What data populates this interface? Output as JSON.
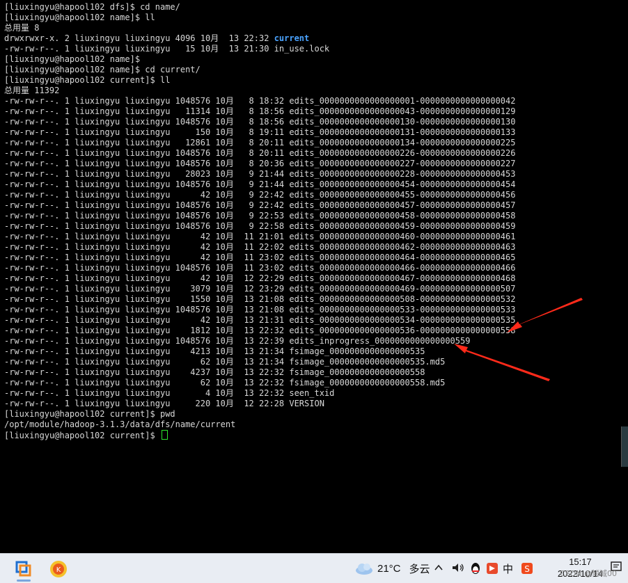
{
  "terminal": {
    "lines": [
      "[liuxingyu@hapool102 dfs]$ cd name/",
      "[liuxingyu@hapool102 name]$ ll",
      "总用量 8"
    ],
    "dir_line_prefix": "drwxrwxr-x. 2 liuxingyu liuxingyu 4096 10月  13 22:32 ",
    "dir_name": "current",
    "lines2": [
      "-rw-rw-r--. 1 liuxingyu liuxingyu   15 10月  13 21:30 in_use.lock",
      "[liuxingyu@hapool102 name]$",
      "[liuxingyu@hapool102 name]$ cd current/",
      "[liuxingyu@hapool102 current]$ ll",
      "总用量 11392",
      "-rw-rw-r--. 1 liuxingyu liuxingyu 1048576 10月   8 18:32 edits_0000000000000000001-0000000000000000042",
      "-rw-rw-r--. 1 liuxingyu liuxingyu   11314 10月   8 18:56 edits_0000000000000000043-0000000000000000129",
      "-rw-rw-r--. 1 liuxingyu liuxingyu 1048576 10月   8 18:56 edits_0000000000000000130-0000000000000000130",
      "-rw-rw-r--. 1 liuxingyu liuxingyu     150 10月   8 19:11 edits_0000000000000000131-0000000000000000133",
      "-rw-rw-r--. 1 liuxingyu liuxingyu   12861 10月   8 20:11 edits_0000000000000000134-0000000000000000225",
      "-rw-rw-r--. 1 liuxingyu liuxingyu 1048576 10月   8 20:11 edits_0000000000000000226-0000000000000000226",
      "-rw-rw-r--. 1 liuxingyu liuxingyu 1048576 10月   8 20:36 edits_0000000000000000227-0000000000000000227",
      "-rw-rw-r--. 1 liuxingyu liuxingyu   28023 10月   9 21:44 edits_0000000000000000228-0000000000000000453",
      "-rw-rw-r--. 1 liuxingyu liuxingyu 1048576 10月   9 21:44 edits_0000000000000000454-0000000000000000454",
      "-rw-rw-r--. 1 liuxingyu liuxingyu      42 10月   9 22:42 edits_0000000000000000455-0000000000000000456",
      "-rw-rw-r--. 1 liuxingyu liuxingyu 1048576 10月   9 22:42 edits_0000000000000000457-0000000000000000457",
      "-rw-rw-r--. 1 liuxingyu liuxingyu 1048576 10月   9 22:53 edits_0000000000000000458-0000000000000000458",
      "-rw-rw-r--. 1 liuxingyu liuxingyu 1048576 10月   9 22:58 edits_0000000000000000459-0000000000000000459",
      "-rw-rw-r--. 1 liuxingyu liuxingyu      42 10月  11 21:01 edits_0000000000000000460-0000000000000000461",
      "-rw-rw-r--. 1 liuxingyu liuxingyu      42 10月  11 22:02 edits_0000000000000000462-0000000000000000463",
      "-rw-rw-r--. 1 liuxingyu liuxingyu      42 10月  11 23:02 edits_0000000000000000464-0000000000000000465",
      "-rw-rw-r--. 1 liuxingyu liuxingyu 1048576 10月  11 23:02 edits_0000000000000000466-0000000000000000466",
      "-rw-rw-r--. 1 liuxingyu liuxingyu      42 10月  12 22:29 edits_0000000000000000467-0000000000000000468",
      "-rw-rw-r--. 1 liuxingyu liuxingyu    3079 10月  12 23:29 edits_0000000000000000469-0000000000000000507",
      "-rw-rw-r--. 1 liuxingyu liuxingyu    1550 10月  13 21:08 edits_0000000000000000508-0000000000000000532",
      "-rw-rw-r--. 1 liuxingyu liuxingyu 1048576 10月  13 21:08 edits_0000000000000000533-0000000000000000533",
      "-rw-rw-r--. 1 liuxingyu liuxingyu      42 10月  13 21:31 edits_0000000000000000534-0000000000000000535",
      "-rw-rw-r--. 1 liuxingyu liuxingyu    1812 10月  13 22:32 edits_0000000000000000536-0000000000000000558",
      "-rw-rw-r--. 1 liuxingyu liuxingyu 1048576 10月  13 22:39 edits_inprogress_0000000000000000559",
      "-rw-rw-r--. 1 liuxingyu liuxingyu    4213 10月  13 21:34 fsimage_0000000000000000535",
      "-rw-rw-r--. 1 liuxingyu liuxingyu      62 10月  13 21:34 fsimage_0000000000000000535.md5",
      "-rw-rw-r--. 1 liuxingyu liuxingyu    4237 10月  13 22:32 fsimage_0000000000000000558",
      "-rw-rw-r--. 1 liuxingyu liuxingyu      62 10月  13 22:32 fsimage_0000000000000000558.md5",
      "-rw-rw-r--. 1 liuxingyu liuxingyu       4 10月  13 22:32 seen_txid",
      "-rw-rw-r--. 1 liuxingyu liuxingyu     220 10月  12 22:28 VERSION",
      "[liuxingyu@hapool102 current]$ pwd",
      "/opt/module/hadoop-3.1.3/data/dfs/name/current"
    ],
    "prompt": "[liuxingyu@hapool102 current]$ ",
    "dir_color": "#4aa3ff",
    "cursor_color": "#2ee62e",
    "arrow_color": "#ff2a1a"
  },
  "taskbar": {
    "apps": [
      "vmware-icon",
      "app-orange-icon"
    ],
    "weather_temp": "21°C",
    "weather_desc": "多云",
    "ime": "中",
    "time": "15:17",
    "date": "2022/10/14",
    "watermark": "CSDN @倾城00"
  }
}
